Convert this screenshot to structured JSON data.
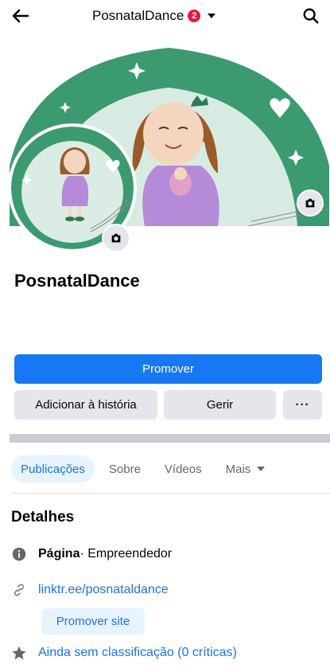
{
  "header": {
    "title": "PosnatalDance",
    "notification_count": "2"
  },
  "profile": {
    "name": "PosnatalDance"
  },
  "actions": {
    "promote": "Promover",
    "add_story": "Adicionar à história",
    "manage": "Gerir",
    "more": "···"
  },
  "tabs": [
    {
      "label": "Publicações",
      "active": true
    },
    {
      "label": "Sobre",
      "active": false
    },
    {
      "label": "Vídeos",
      "active": false
    },
    {
      "label": "Mais",
      "active": false
    }
  ],
  "details": {
    "title": "Detalhes",
    "category_label": "Página",
    "category_value": " · Empreendedor",
    "link": "linktr.ee/posnataldance",
    "promote_site": "Promover site",
    "rating": "Ainda sem classificação (0 críticas)"
  },
  "colors": {
    "brand_blue": "#1877f2",
    "link_blue": "#1b74e4",
    "badge_red": "#e41e3f",
    "cover_green": "#3c9a70",
    "cover_light": "#d8ebe2"
  },
  "icons": {
    "back": "arrow-left-icon",
    "search": "search-icon",
    "camera": "camera-icon",
    "info": "info-icon",
    "link": "link-icon",
    "star": "star-icon"
  }
}
